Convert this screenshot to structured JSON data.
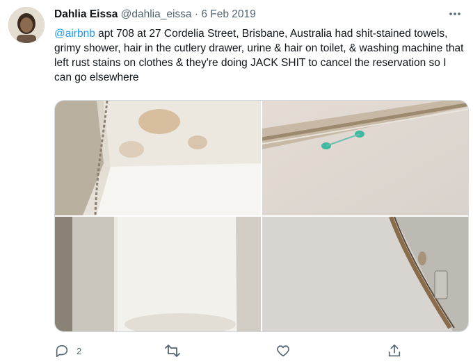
{
  "tweet": {
    "author_name": "Dahlia Eissa",
    "handle": "@dahlia_eissa",
    "separator": "·",
    "date": "6 Feb 2019",
    "mention": "@airbnb",
    "body": " apt 708 at 27 Cordelia Street, Brisbane, Australia had shit-stained towels, grimy shower, hair in the cutlery drawer, urine & hair on toilet, & washing machine that left rust stains on clothes & they're doing JACK SHIT to cancel the reservation so I can go elsewhere"
  },
  "media": [
    {
      "name": "stained-towel-photo"
    },
    {
      "name": "shower-stains-photo"
    },
    {
      "name": "toilet-photo"
    },
    {
      "name": "washing-machine-rust-photo"
    }
  ],
  "actions": {
    "reply_icon": "reply-icon",
    "reply_count": "2",
    "retweet_icon": "retweet-icon",
    "like_icon": "heart-icon",
    "share_icon": "share-icon"
  },
  "colors": {
    "accent": "#1d9bf0",
    "text": "#0f1419",
    "secondary": "#536471",
    "border": "#cfd9de"
  }
}
